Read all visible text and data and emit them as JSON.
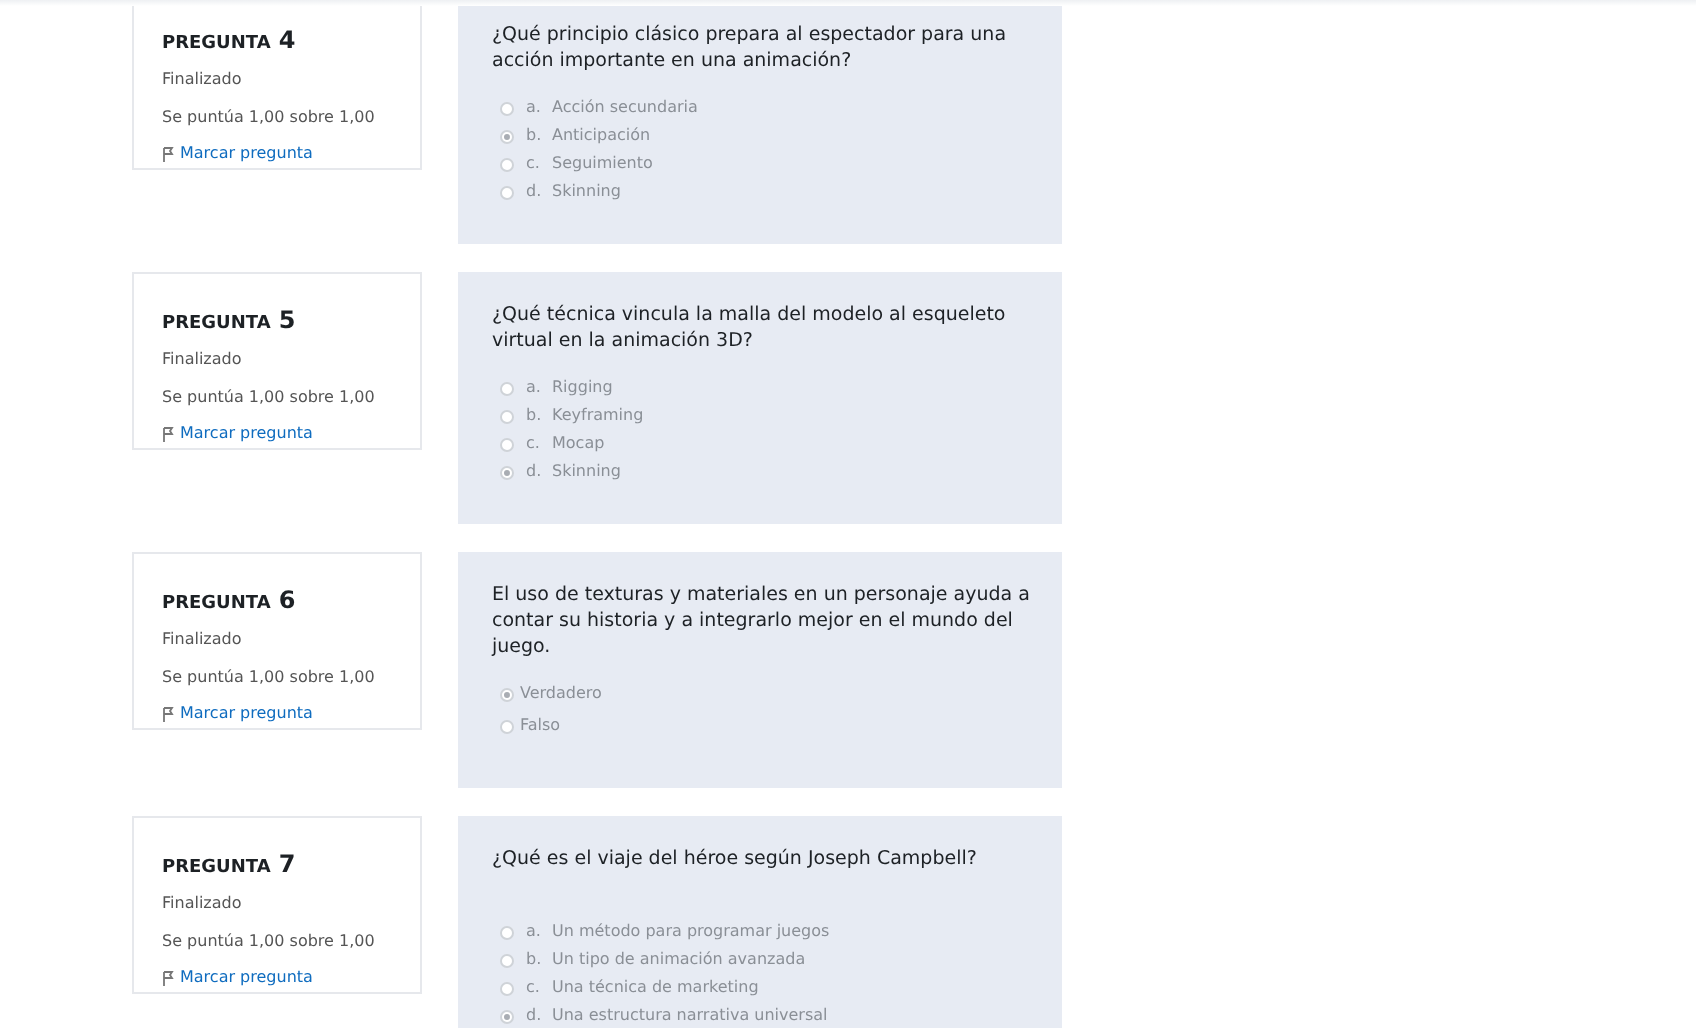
{
  "questions": [
    {
      "label": "PREGUNTA",
      "number": "4",
      "state": "Finalizado",
      "grade": "Se puntúa 1,00 sobre 1,00",
      "flag_link": "Marcar pregunta",
      "text": "¿Qué principio clásico prepara al espectador para una acción importante en una animación?",
      "options": [
        {
          "letter": "a.",
          "text": "Acción secundaria",
          "selected": false
        },
        {
          "letter": "b.",
          "text": "Anticipación",
          "selected": true
        },
        {
          "letter": "c.",
          "text": "Seguimiento",
          "selected": false
        },
        {
          "letter": "d.",
          "text": "Skinning",
          "selected": false
        }
      ]
    },
    {
      "label": "PREGUNTA",
      "number": "5",
      "state": "Finalizado",
      "grade": "Se puntúa 1,00 sobre 1,00",
      "flag_link": "Marcar pregunta",
      "text": "¿Qué técnica vincula la malla del modelo al esqueleto virtual en la animación 3D?",
      "options": [
        {
          "letter": "a.",
          "text": "Rigging",
          "selected": false
        },
        {
          "letter": "b.",
          "text": "Keyframing",
          "selected": false
        },
        {
          "letter": "c.",
          "text": "Mocap",
          "selected": false
        },
        {
          "letter": "d.",
          "text": "Skinning",
          "selected": true
        }
      ]
    },
    {
      "label": "PREGUNTA",
      "number": "6",
      "state": "Finalizado",
      "grade": "Se puntúa 1,00 sobre 1,00",
      "flag_link": "Marcar pregunta",
      "text": "El uso de texturas y materiales en un personaje ayuda a contar su historia y a integrarlo mejor en el mundo del juego.",
      "options": [
        {
          "text": "Verdadero",
          "selected": true
        },
        {
          "text": "Falso",
          "selected": false
        }
      ]
    },
    {
      "label": "PREGUNTA",
      "number": "7",
      "state": "Finalizado",
      "grade": "Se puntúa 1,00 sobre 1,00",
      "flag_link": "Marcar pregunta",
      "text": "¿Qué es el viaje del héroe según Joseph Campbell?",
      "options": [
        {
          "letter": "a.",
          "text": "Un método para programar juegos",
          "selected": false
        },
        {
          "letter": "b.",
          "text": "Un tipo de animación avanzada",
          "selected": false
        },
        {
          "letter": "c.",
          "text": "Una técnica de marketing",
          "selected": false
        },
        {
          "letter": "d.",
          "text": "Una estructura narrativa universal",
          "selected": true
        }
      ]
    }
  ]
}
